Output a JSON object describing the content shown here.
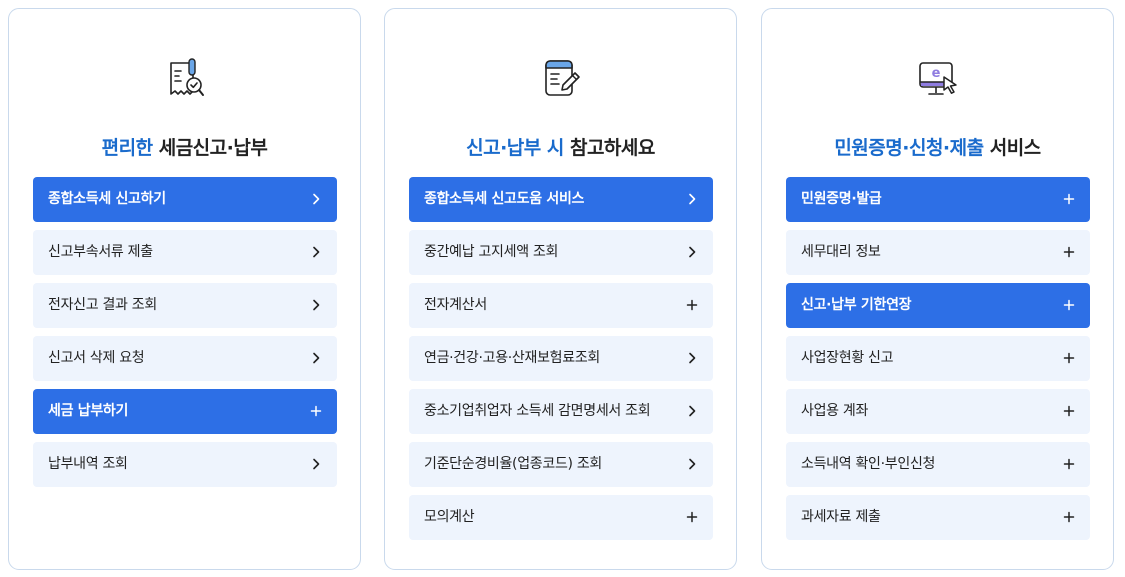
{
  "colors": {
    "accent_blue": "#1a6bcc",
    "primary_button": "#2d6fe6",
    "item_background": "#eef4fd",
    "card_border": "#c9d9ec"
  },
  "cards": [
    {
      "icon": "receipt-magnifier-icon",
      "title_highlight": "편리한",
      "title_rest": " 세금신고·납부",
      "items": [
        {
          "label": "종합소득세 신고하기",
          "style": "primary",
          "trail_icon": "chevron-right-icon"
        },
        {
          "label": "신고부속서류 제출",
          "style": "default",
          "trail_icon": "chevron-right-icon"
        },
        {
          "label": "전자신고 결과 조회",
          "style": "default",
          "trail_icon": "chevron-right-icon"
        },
        {
          "label": "신고서 삭제 요청",
          "style": "default",
          "trail_icon": "chevron-right-icon"
        },
        {
          "label": "세금 납부하기",
          "style": "primary",
          "trail_icon": "plus-icon"
        },
        {
          "label": "납부내역 조회",
          "style": "default",
          "trail_icon": "chevron-right-icon"
        }
      ]
    },
    {
      "icon": "document-pencil-icon",
      "title_highlight": "신고·납부 시",
      "title_rest": " 참고하세요",
      "items": [
        {
          "label": "종합소득세 신고도움 서비스",
          "style": "primary",
          "trail_icon": "chevron-right-icon"
        },
        {
          "label": "중간예납 고지세액 조회",
          "style": "default",
          "trail_icon": "chevron-right-icon"
        },
        {
          "label": "전자계산서",
          "style": "default",
          "trail_icon": "plus-icon"
        },
        {
          "label": "연금·건강·고용·산재보험료조회",
          "style": "default",
          "trail_icon": "chevron-right-icon"
        },
        {
          "label": "중소기업취업자 소득세 감면명세서 조회",
          "style": "default",
          "trail_icon": "chevron-right-icon"
        },
        {
          "label": "기준단순경비율(업종코드) 조회",
          "style": "default",
          "trail_icon": "chevron-right-icon"
        },
        {
          "label": "모의계산",
          "style": "default",
          "trail_icon": "plus-icon"
        }
      ]
    },
    {
      "icon": "monitor-cursor-icon",
      "icon_letter": "e",
      "title_highlight": "민원증명·신청·제출",
      "title_rest": " 서비스",
      "items": [
        {
          "label": "민원증명·발급",
          "style": "primary",
          "trail_icon": "plus-icon"
        },
        {
          "label": "세무대리 정보",
          "style": "default",
          "trail_icon": "plus-icon"
        },
        {
          "label": "신고·납부 기한연장",
          "style": "primary",
          "trail_icon": "plus-icon"
        },
        {
          "label": "사업장현황 신고",
          "style": "default",
          "trail_icon": "plus-icon"
        },
        {
          "label": "사업용 계좌",
          "style": "default",
          "trail_icon": "plus-icon"
        },
        {
          "label": "소득내역 확인·부인신청",
          "style": "default",
          "trail_icon": "plus-icon"
        },
        {
          "label": "과세자료 제출",
          "style": "default",
          "trail_icon": "plus-icon"
        }
      ]
    }
  ]
}
